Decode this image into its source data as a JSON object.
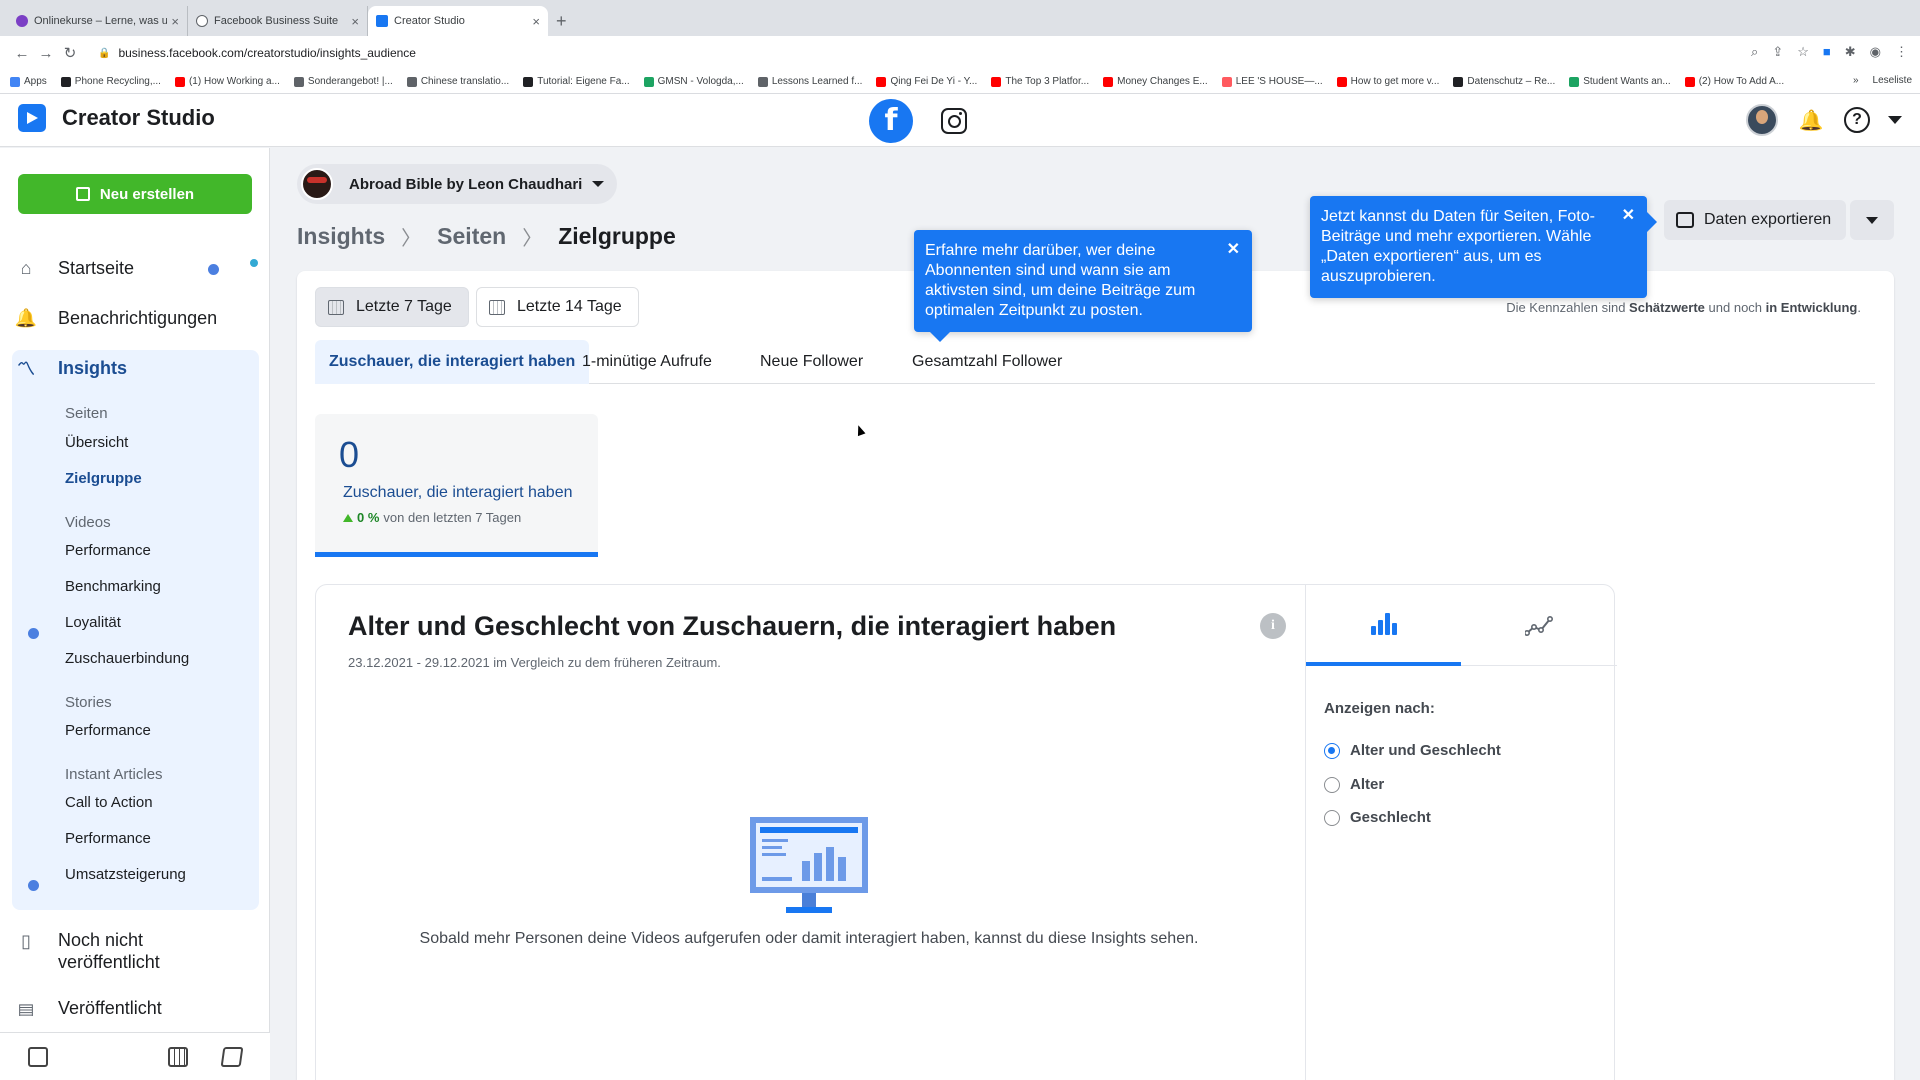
{
  "browser": {
    "tabs": [
      {
        "title": "Onlinekurse – Lerne, was und w",
        "color": "#7b3fc5"
      },
      {
        "title": "Facebook Business Suite",
        "color": "#5f6368"
      },
      {
        "title": "Creator Studio",
        "color": "#1877f2"
      }
    ],
    "url": "business.facebook.com/creatorstudio/insights_audience",
    "bookmarks": [
      {
        "label": "Apps",
        "color": "#4285f4"
      },
      {
        "label": "Phone Recycling,...",
        "color": "#202124"
      },
      {
        "label": "(1) How Working a...",
        "color": "#ff0000"
      },
      {
        "label": "Sonderangebot! |...",
        "color": "#5f6368"
      },
      {
        "label": "Chinese translatio...",
        "color": "#5f6368"
      },
      {
        "label": "Tutorial: Eigene Fa...",
        "color": "#202124"
      },
      {
        "label": "GMSN - Vologda,...",
        "color": "#1da462"
      },
      {
        "label": "Lessons Learned f...",
        "color": "#5f6368"
      },
      {
        "label": "Qing Fei De Yi - Y...",
        "color": "#ff0000"
      },
      {
        "label": "The Top 3 Platfor...",
        "color": "#ff0000"
      },
      {
        "label": "Money Changes E...",
        "color": "#ff0000"
      },
      {
        "label": "LEE 'S HOUSE—...",
        "color": "#ff5a5f"
      },
      {
        "label": "How to get more v...",
        "color": "#ff0000"
      },
      {
        "label": "Datenschutz – Re...",
        "color": "#202124"
      },
      {
        "label": "Student Wants an...",
        "color": "#1da462"
      },
      {
        "label": "(2) How To Add A...",
        "color": "#ff0000"
      }
    ],
    "reading_list": "Leseliste"
  },
  "header": {
    "app_title": "Creator Studio",
    "fb_glyph": "f"
  },
  "sidebar": {
    "new_button": "Neu erstellen",
    "home": "Startseite",
    "notifications": "Benachrichtigungen",
    "insights": "Insights",
    "sections": {
      "pages": "Seiten",
      "videos": "Videos",
      "stories": "Stories",
      "instant_articles": "Instant Articles"
    },
    "items": {
      "overview": "Übersicht",
      "audience": "Zielgruppe",
      "video_performance": "Performance",
      "benchmarking": "Benchmarking",
      "loyalty": "Loyalität",
      "audience_retention": "Zuschauerbindung",
      "stories_performance": "Performance",
      "cta": "Call to Action",
      "ia_performance": "Performance",
      "revenue": "Umsatzsteigerung"
    },
    "unpublished": "Noch nicht veröffentlicht",
    "published": "Veröffentlicht"
  },
  "main": {
    "page_name": "Abroad Bible by Leon Chaudhari",
    "breadcrumb": [
      "Insights",
      "Seiten",
      "Zielgruppe"
    ],
    "export_label": "Daten exportieren",
    "range_buttons": [
      "Letzte 7 Tage",
      "Letzte 14 Tage"
    ],
    "note_pre": "Die Kennzahlen sind ",
    "note_bold1": "Schätzwerte",
    "note_mid": " und noch ",
    "note_bold2": "in Entwicklung",
    "note_post": ".",
    "metric_tabs": [
      "Zuschauer, die interagiert haben",
      "1-minütige Aufrufe",
      "Neue Follower",
      "Gesamtzahl Follower"
    ],
    "kpi": {
      "value": "0",
      "label": "Zuschauer, die interagiert haben",
      "delta": "0 %",
      "delta_text": "von den letzten 7 Tagen"
    },
    "panel": {
      "title": "Alter und Geschlecht von Zuschauern, die interagiert haben",
      "subtitle": "23.12.2021 - 29.12.2021 im Vergleich zu dem früheren Zeitraum.",
      "empty_text": "Sobald mehr Personen deine Videos aufgerufen oder damit interagiert haben, kannst du diese Insights sehen.",
      "show_by": "Anzeigen nach:",
      "options": [
        "Alter und Geschlecht",
        "Alter",
        "Geschlecht"
      ],
      "selected_option": "Alter und Geschlecht"
    }
  },
  "tooltips": {
    "audience_tip": "Erfahre mehr darüber, wer deine Abonnenten sind und wann sie am aktivsten sind, um deine Beiträge zum optimalen Zeitpunkt zu posten.",
    "export_tip": "Jetzt kannst du Daten für Seiten, Foto-Beiträge und mehr exportieren. Wähle „Daten exportieren“ aus, um es auszuprobieren."
  },
  "colors": {
    "brand": "#1877f2",
    "create_button": "#42b72a",
    "active_nav": "#1b4d92"
  }
}
